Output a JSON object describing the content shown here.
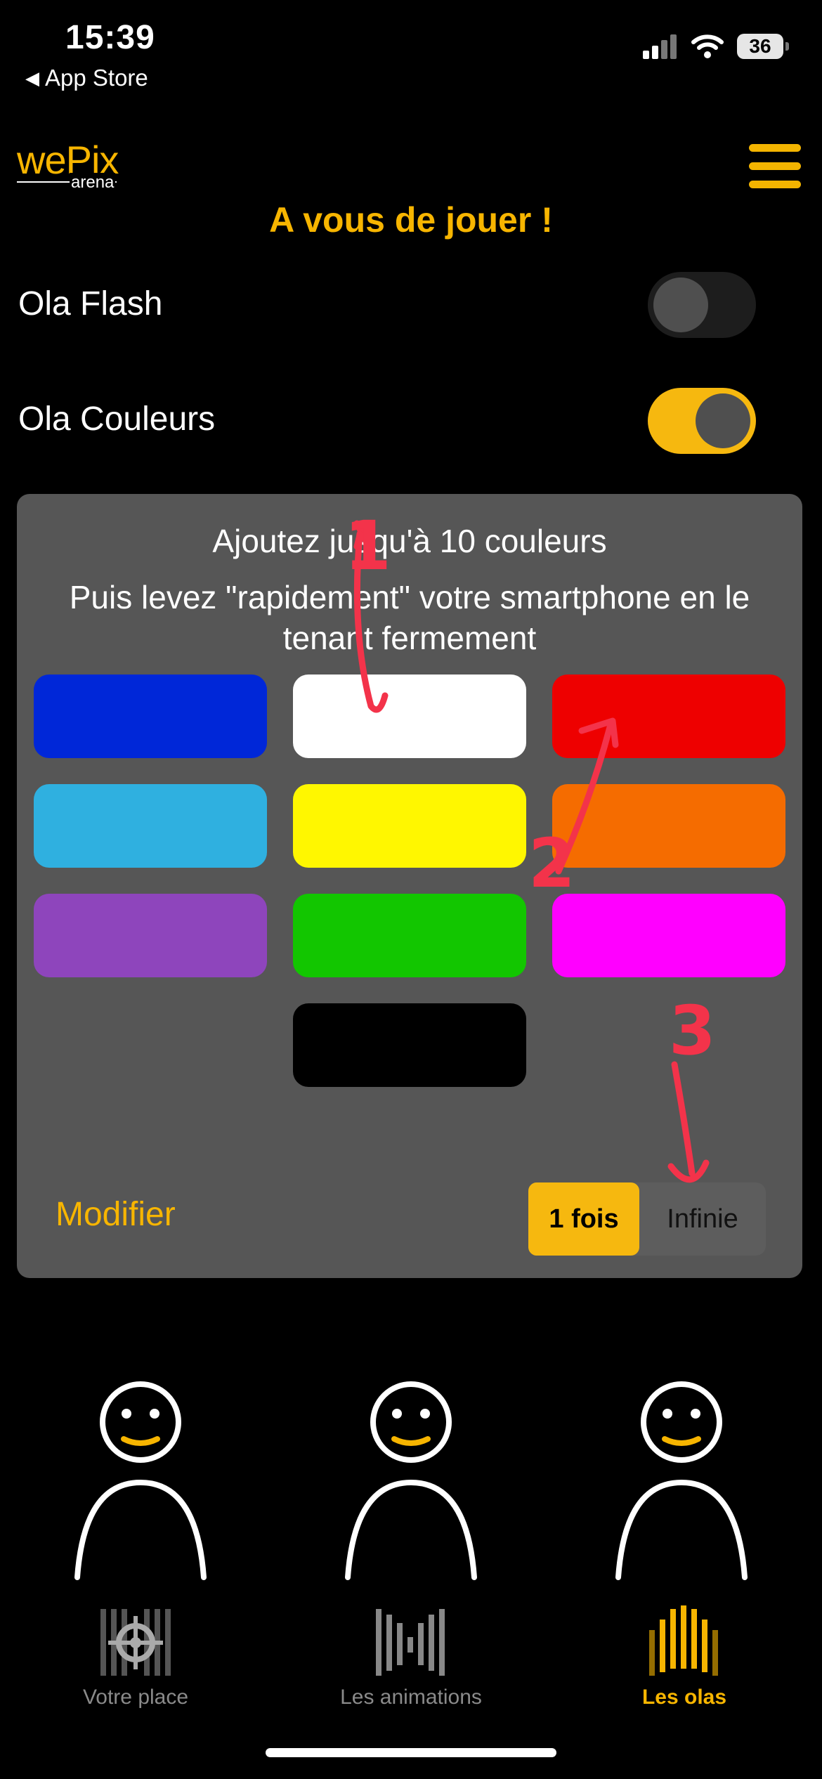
{
  "status_bar": {
    "time": "15:39",
    "back_label": "App Store",
    "battery": "36"
  },
  "header": {
    "logo": "wePix",
    "logo_sub": "arena",
    "title": "A vous de jouer !"
  },
  "options": [
    {
      "label": "Ola Flash",
      "on": false
    },
    {
      "label": "Ola Couleurs",
      "on": true
    }
  ],
  "panel": {
    "line1": "Ajoutez jusqu'à 10 couleurs",
    "line2": "Puis levez \"rapidement\" votre smartphone en le tenant fermement",
    "colors": [
      "#0027d8",
      "#ffffff",
      "#ee0000",
      "#2fb0e0",
      "#fff700",
      "#f56c00",
      "#8e45bc",
      "#12c600",
      "#ff00ff",
      "#000000"
    ],
    "modify_label": "Modifier",
    "repeat": {
      "options": [
        "1 fois",
        "Infinie"
      ],
      "selected": "1 fois"
    }
  },
  "annotations": [
    "1",
    "2",
    "3"
  ],
  "tabs": [
    {
      "label": "Votre place",
      "active": false
    },
    {
      "label": "Les animations",
      "active": false
    },
    {
      "label": "Les olas",
      "active": true
    }
  ],
  "accent": "#f7b500"
}
